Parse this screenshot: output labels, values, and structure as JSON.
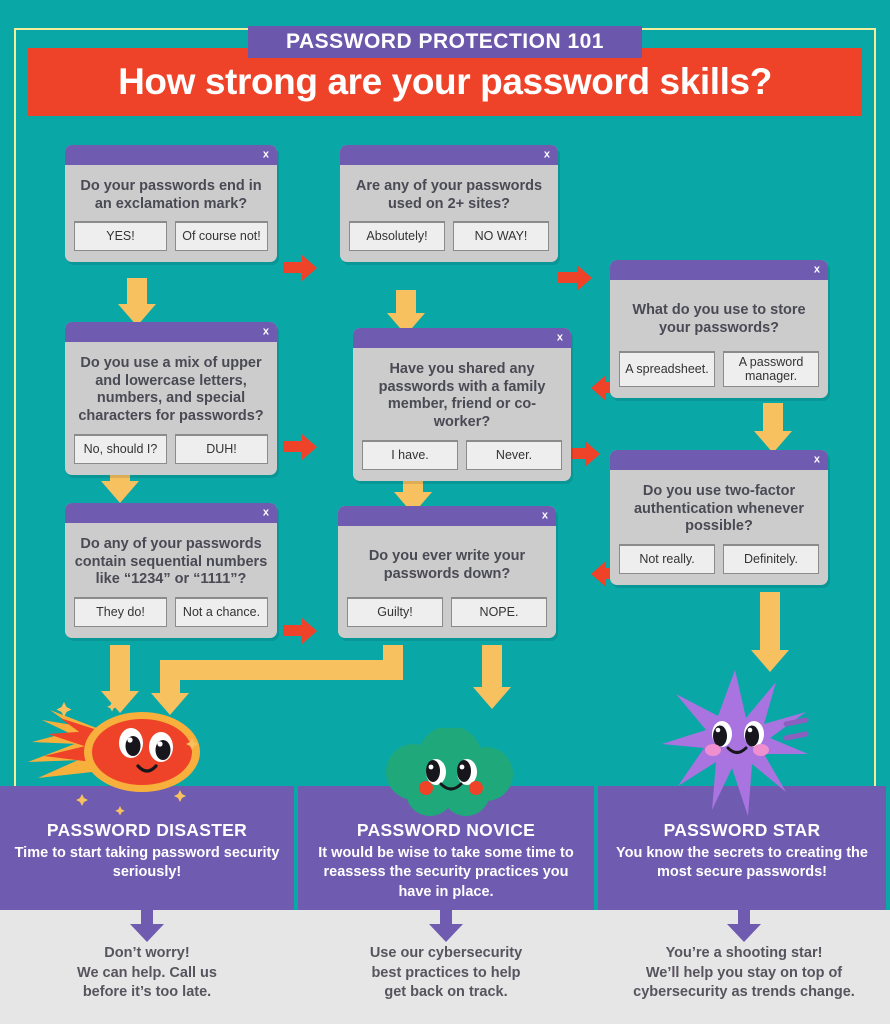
{
  "header": {
    "kicker": "PASSWORD PROTECTION 101",
    "headline": "How strong are your password skills?"
  },
  "theme": {
    "background": "#0aa7a7",
    "accent_red": "#ee4328",
    "purple": "#6f5bb0",
    "yellow_arrow": "#f7c160",
    "dialog_gray": "#cccccc",
    "footer_gray": "#e6e6e6",
    "frame_yellow": "#f2ee9c"
  },
  "dialogs": [
    {
      "id": "q1",
      "close_label": "x",
      "question": "Do your passwords end in an exclamation mark?",
      "buttons": [
        {
          "label": "YES!"
        },
        {
          "label": "Of course not!"
        }
      ]
    },
    {
      "id": "q2",
      "close_label": "x",
      "question": "Are any of your passwords used on 2+ sites?",
      "buttons": [
        {
          "label": "Absolutely!"
        },
        {
          "label": "NO WAY!"
        }
      ]
    },
    {
      "id": "q3",
      "close_label": "x",
      "question": "What do you use to store your passwords?",
      "buttons": [
        {
          "label": "A spreadsheet."
        },
        {
          "label": "A password manager."
        }
      ]
    },
    {
      "id": "q4",
      "close_label": "x",
      "question": "Do you use a mix of upper and lowercase letters, numbers, and special characters for passwords?",
      "buttons": [
        {
          "label": "No, should I?"
        },
        {
          "label": "DUH!"
        }
      ]
    },
    {
      "id": "q5",
      "close_label": "x",
      "question": "Have you shared any passwords with a family member, friend or co-worker?",
      "buttons": [
        {
          "label": "I have."
        },
        {
          "label": "Never."
        }
      ]
    },
    {
      "id": "q6",
      "close_label": "x",
      "question": "Do you use two-factor authentication whenever possible?",
      "buttons": [
        {
          "label": "Not really."
        },
        {
          "label": "Definitely."
        }
      ]
    },
    {
      "id": "q7",
      "close_label": "x",
      "question": "Do any of your passwords contain sequential numbers like “1234” or “1111”?",
      "buttons": [
        {
          "label": "They do!"
        },
        {
          "label": "Not a chance."
        }
      ]
    },
    {
      "id": "q8",
      "close_label": "x",
      "question": "Do you ever write your passwords down?",
      "buttons": [
        {
          "label": "Guilty!"
        },
        {
          "label": "NOPE."
        }
      ]
    }
  ],
  "results": [
    {
      "mascot": "comet-icon",
      "title": "PASSWORD DISASTER",
      "description": "Time to start taking password security seriously!",
      "footer": "Don’t worry!\nWe can help. Call us\nbefore it’s too late."
    },
    {
      "mascot": "cloud-icon",
      "title": "PASSWORD NOVICE",
      "description": "It would be wise to take some time to reassess the security practices you have in place.",
      "footer": "Use our cybersecurity\nbest practices to help\nget back on track."
    },
    {
      "mascot": "star-icon",
      "title": "PASSWORD STAR",
      "description": "You know the secrets to creating the most secure passwords!",
      "footer": "You’re a shooting star!\nWe’ll help you stay on top of\ncybersecurity as trends change."
    }
  ]
}
